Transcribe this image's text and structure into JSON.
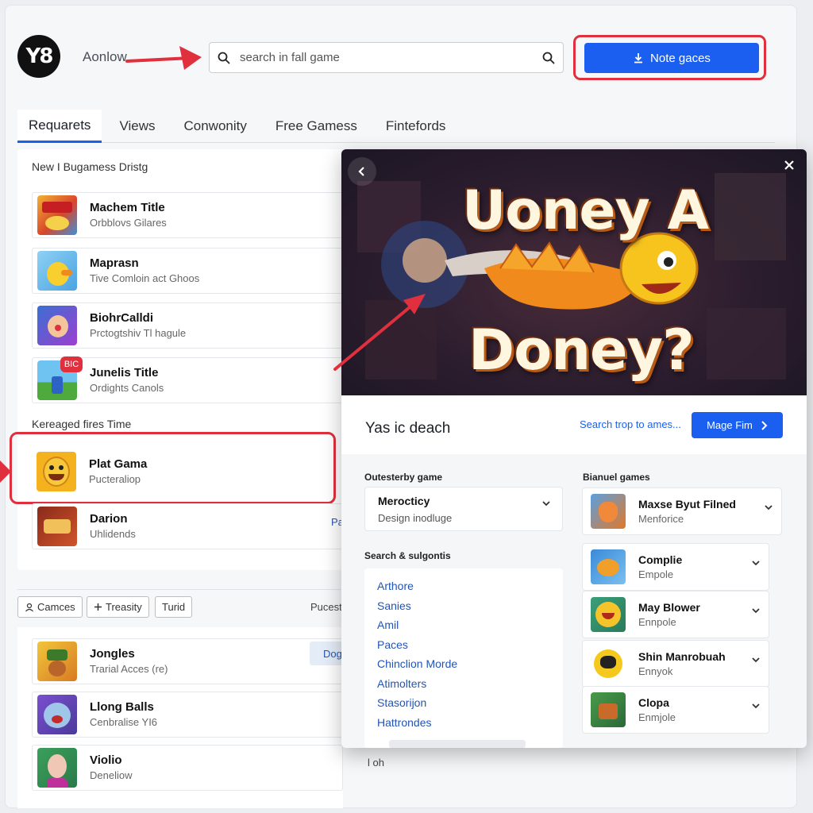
{
  "header": {
    "logo_text": "Y8",
    "brand_name": "Aonlow",
    "search_placeholder": "search in fall game",
    "cta_label": "Note gaces"
  },
  "tabs": [
    {
      "label": "Requarets",
      "active": true
    },
    {
      "label": "Views"
    },
    {
      "label": "Conwonity"
    },
    {
      "label": "Free Gamess"
    },
    {
      "label": "Fintefords"
    }
  ],
  "left": {
    "section1_title": "New I Bugamess Dristg",
    "section2_title": "Kereaged fires Time",
    "games": [
      {
        "title": "Machem Title",
        "sub": "Orbblovs Gilares",
        "icon": "arcade-game-thumbnail"
      },
      {
        "title": "Maprasn",
        "sub": "Tive Comloin act Ghoos",
        "icon": "duck-cartoon-thumbnail"
      },
      {
        "title": "BiohrCalldi",
        "sub": "Prctogtshiv Tl hagule",
        "icon": "clown-character-thumbnail"
      },
      {
        "title": "Junelis Title",
        "sub": "Ordights Canols",
        "icon": "farm-scene-thumbnail",
        "badge": "BIC"
      },
      {
        "title": "Plat Gama",
        "sub": "Pucteraliop",
        "icon": "smiley-face-thumbnail"
      },
      {
        "title": "Darion",
        "sub": "Uhlidends",
        "icon": "action-game-thumbnail"
      }
    ],
    "filters": [
      {
        "label": "Camces",
        "icon": "user-icon"
      },
      {
        "label": "Treasity",
        "icon": "plus-icon"
      },
      {
        "label": "Turid",
        "icon": ""
      }
    ],
    "side_label_1": "Pucest",
    "side_label_2": "Pa",
    "side_button": "Dog",
    "more_games": [
      {
        "title": "Jongles",
        "sub": "Trarial Acces (re)",
        "icon": "jungle-character-thumbnail"
      },
      {
        "title": "Llong Balls",
        "sub": "Cenbralise YI6",
        "icon": "monster-character-thumbnail"
      },
      {
        "title": "Violio",
        "sub": "Deneliow",
        "icon": "clown-portrait-thumbnail"
      }
    ],
    "footer_text": "l oh"
  },
  "modal": {
    "hero_line1": "Uoney A",
    "hero_line2": "Doney?",
    "title": "Yas ic deach",
    "link": "Search trop to ames...",
    "button": "Mage Fim",
    "dropdown_label": "Outesterby game",
    "dropdown_value": "Merocticy",
    "dropdown_sub": "Design inodluge",
    "suggestions_label": "Search & sulgontis",
    "suggestions": [
      "Arthore",
      "Sanies",
      "Amil",
      "Paces",
      "Chinclion Morde",
      "Atimolters",
      "Stasorijon",
      "Hattrondes"
    ],
    "bundle_label": "Bianuel games",
    "bundle": [
      {
        "title": "Maxse Byut Filned",
        "sub": "Menforice",
        "icon": "fox-character-thumbnail"
      },
      {
        "title": "Complie",
        "sub": "Empole",
        "icon": "bird-character-thumbnail"
      },
      {
        "title": "May Blower",
        "sub": "Ennpole",
        "icon": "lion-character-thumbnail"
      },
      {
        "title": "Shin Manrobuah",
        "sub": "Ennyok",
        "icon": "bee-character-thumbnail"
      },
      {
        "title": "Clopa",
        "sub": "Enmjole",
        "icon": "forest-scene-thumbnail"
      }
    ]
  },
  "colors": {
    "accent": "#1a5ff0",
    "annotation_red": "#e0303e"
  }
}
